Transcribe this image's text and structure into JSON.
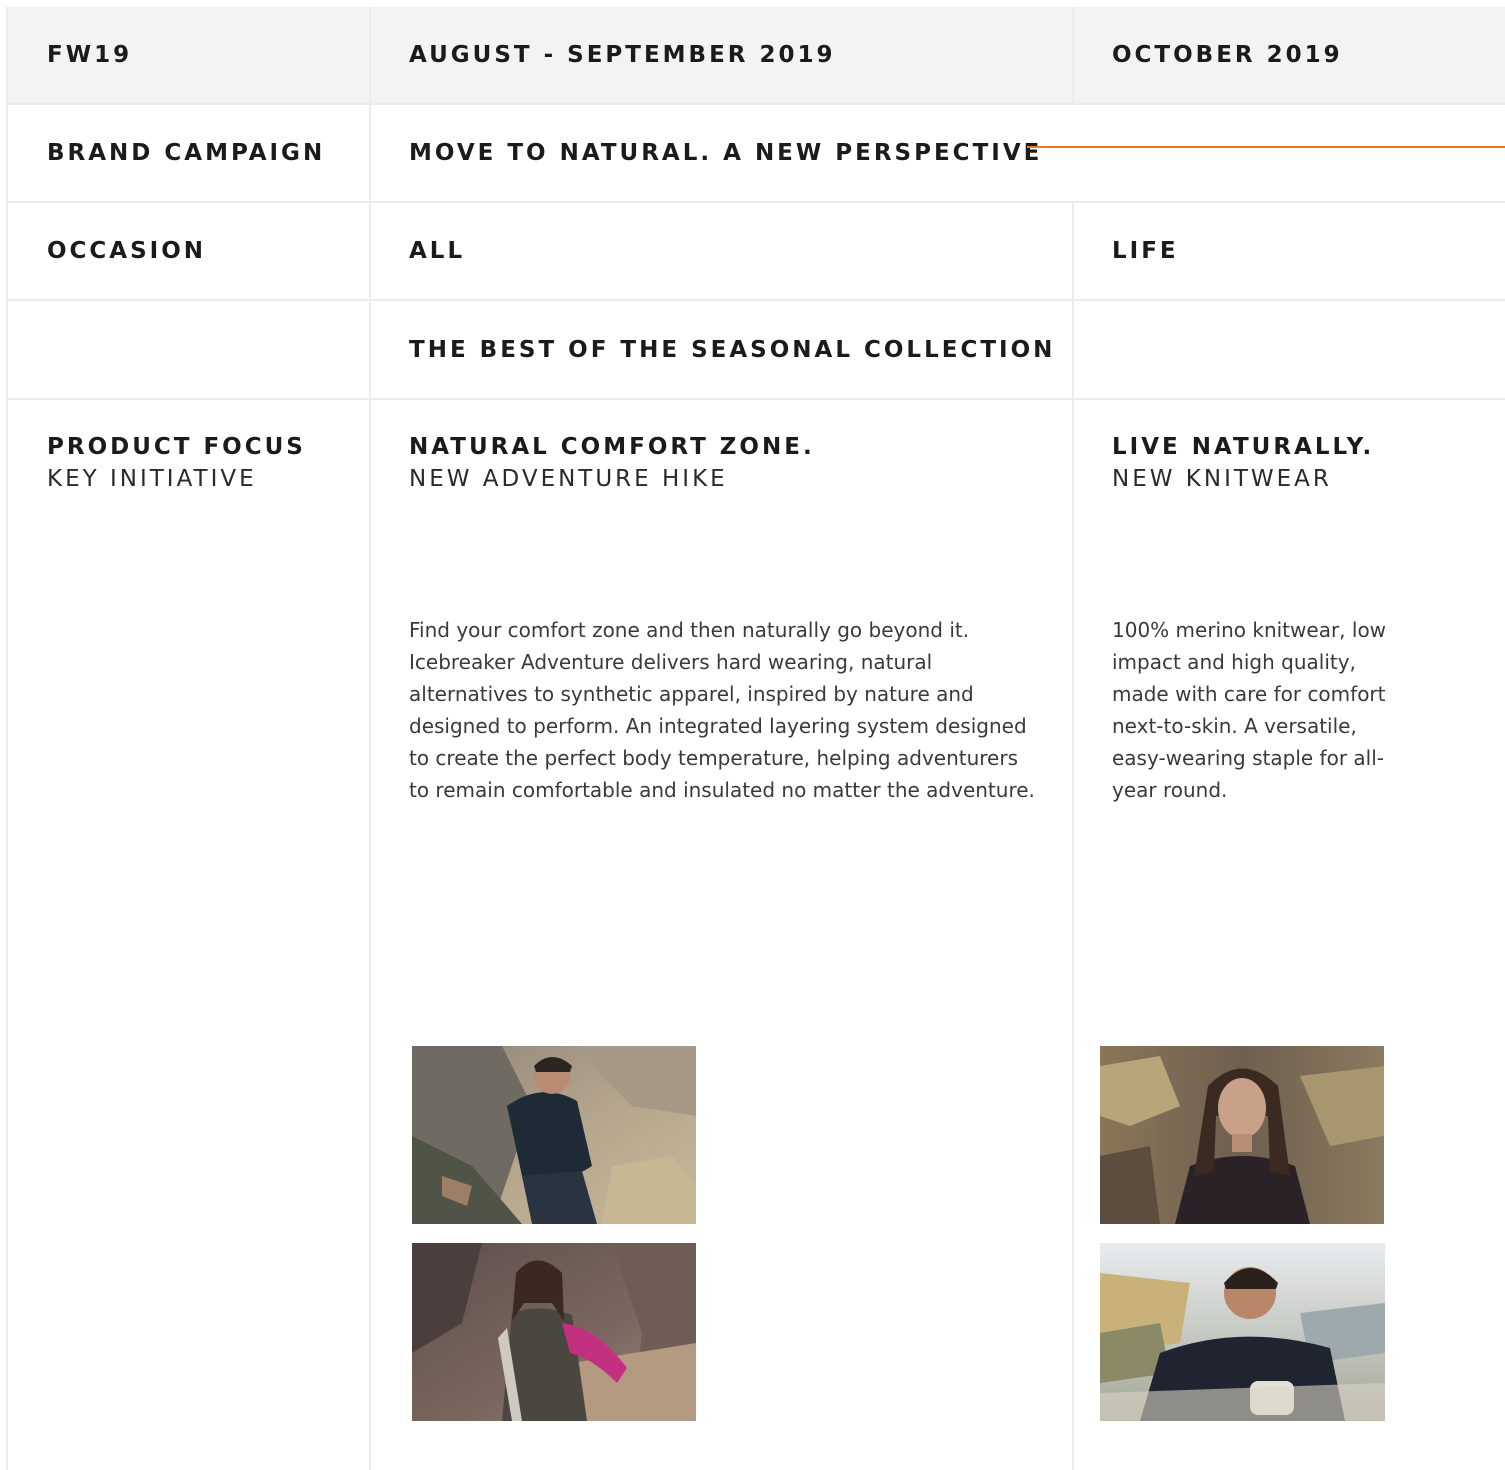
{
  "header": {
    "season": "FW19",
    "period_1": "AUGUST - SEPTEMBER 2019",
    "period_2": "OCTOBER 2019"
  },
  "brand_campaign": {
    "label": "BRAND CAMPAIGN",
    "value": "MOVE TO NATURAL. A NEW PERSPECTIVE",
    "accent_color": "#e87a2c"
  },
  "occasion": {
    "label": "OCCASION",
    "value_1": "ALL",
    "value_2": "LIFE"
  },
  "collection": {
    "value": "THE BEST OF THE SEASONAL COLLECTION"
  },
  "product_focus": {
    "label": "PRODUCT FOCUS",
    "sublabel": "KEY INITIATIVE",
    "col1": {
      "title": "NATURAL COMFORT ZONE.",
      "subtitle": "NEW ADVENTURE HIKE",
      "body": "Find your comfort zone and then naturally go beyond it. Icebreaker Adventure delivers hard wearing, natural alternatives to synthetic apparel, inspired by nature and designed to perform. An integrated layering system designed to create the perfect body temperature, helping adventurers to remain comfortable and insulated no matter the adventure."
    },
    "col2": {
      "title": "LIVE NATURALLY.",
      "subtitle": "NEW KNITWEAR",
      "body": "100% merino knitwear, low impact and high quality, made with care for comfort next-to-skin. A versatile, easy-wearing staple for all-year round."
    }
  }
}
